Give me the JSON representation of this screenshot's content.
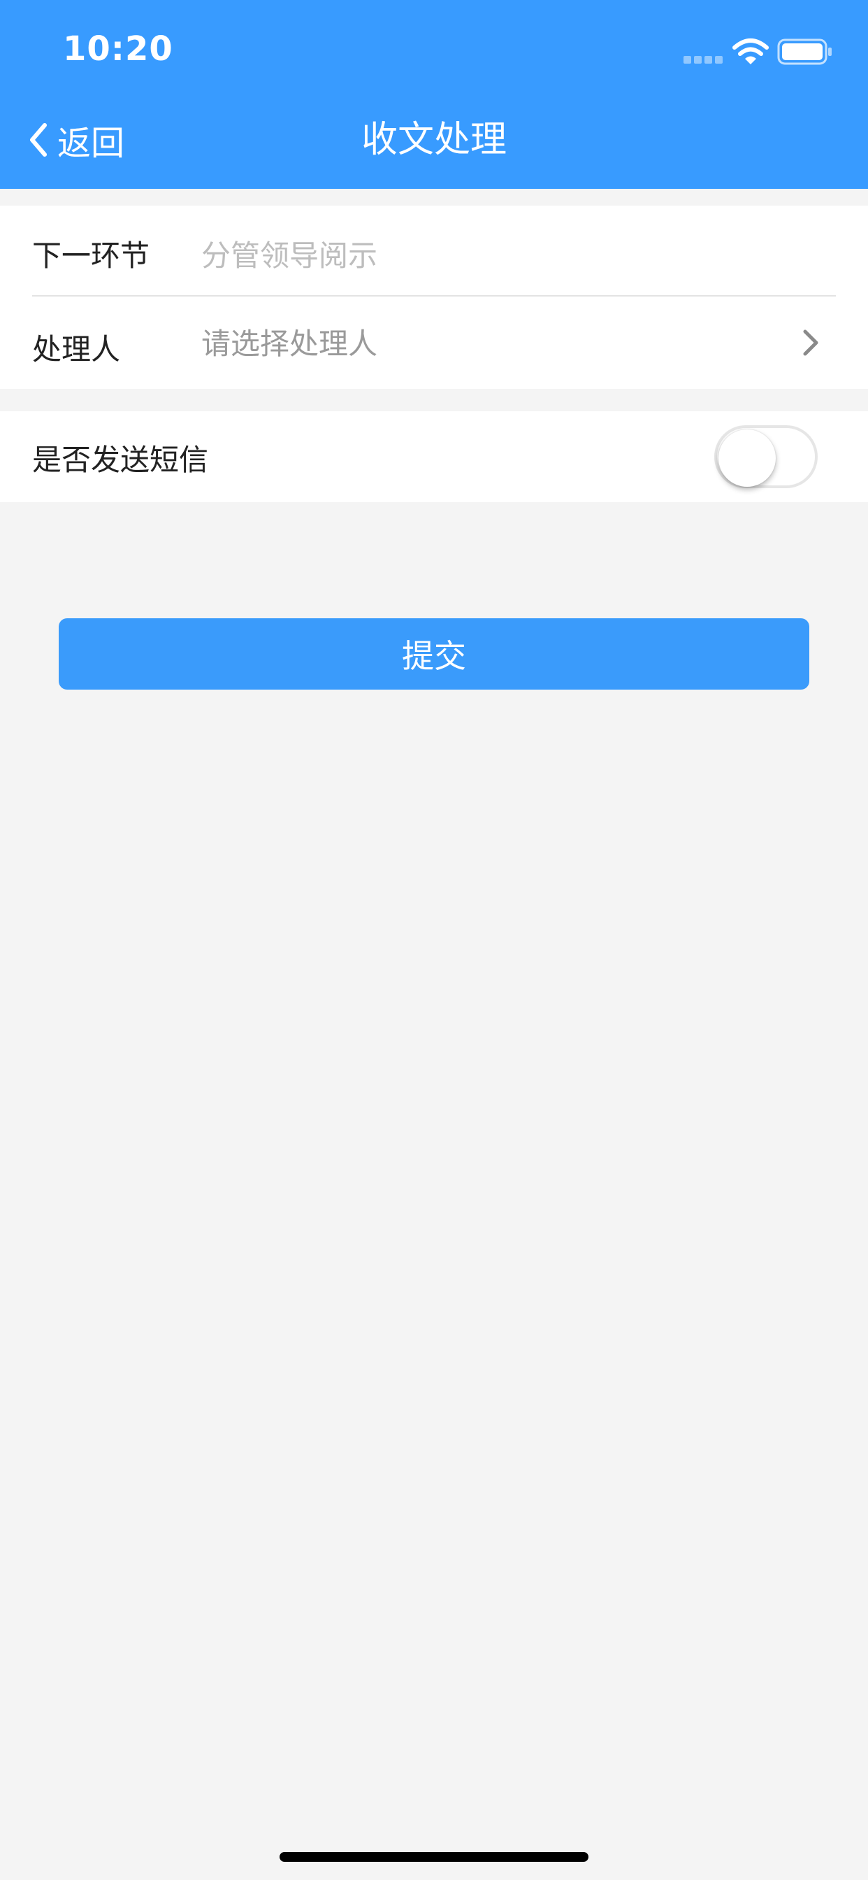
{
  "status_bar": {
    "time": "10:20"
  },
  "nav": {
    "back_label": "返回",
    "title": "收文处理"
  },
  "form": {
    "next_step": {
      "label": "下一环节",
      "value": "分管领导阅示"
    },
    "handler": {
      "label": "处理人",
      "placeholder": "请选择处理人"
    },
    "send_sms": {
      "label": "是否发送短信",
      "enabled": false
    }
  },
  "submit_label": "提交",
  "colors": {
    "accent": "#389bff",
    "background": "#f4f4f4"
  },
  "icons": [
    "chevron-left-icon",
    "chevron-right-icon",
    "wifi-icon",
    "battery-icon",
    "signal-icon"
  ]
}
